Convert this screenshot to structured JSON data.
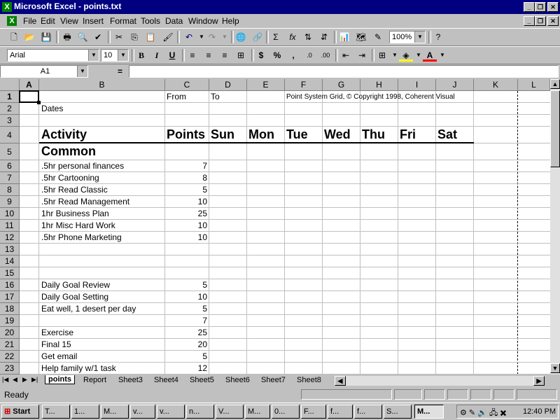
{
  "window": {
    "title": "Microsoft Excel - points.txt",
    "app_icon": "excel-icon"
  },
  "menu": [
    "File",
    "Edit",
    "View",
    "Insert",
    "Format",
    "Tools",
    "Data",
    "Window",
    "Help"
  ],
  "toolbar": {
    "zoom": "100%",
    "font": "Arial",
    "size": "10"
  },
  "namebox": "A1",
  "formula_eq": "=",
  "columns": [
    "A",
    "B",
    "C",
    "D",
    "E",
    "F",
    "G",
    "H",
    "I",
    "J",
    "K",
    "L"
  ],
  "rows": [
    "1",
    "2",
    "3",
    "4",
    "5",
    "6",
    "7",
    "8",
    "9",
    "10",
    "11",
    "12",
    "13",
    "14",
    "15",
    "16",
    "17",
    "18",
    "19",
    "20",
    "21",
    "22",
    "23"
  ],
  "cells": {
    "c1": "From",
    "d1": "To",
    "f1": "Point System Grid, © Copyright 1998, Coherent Visual",
    "b2": "Dates",
    "b4": "Activity",
    "c4": "Points",
    "d4": "Sun",
    "e4": "Mon",
    "f4": "Tue",
    "g4": "Wed",
    "h4": "Thu",
    "i4": "Fri",
    "j4": "Sat",
    "b5": "Common",
    "b6": ".5hr personal finances",
    "c6": "7",
    "b7": ".5hr Cartooning",
    "c7": "8",
    "b8": ".5hr Read Classic",
    "c8": "5",
    "b9": ".5hr Read Management",
    "c9": "10",
    "b10": "1hr Business Plan",
    "c10": "25",
    "b11": "1hr Misc Hard Work",
    "c11": "10",
    "b12": ".5hr Phone Marketing",
    "c12": "10",
    "b16": "Daily Goal Review",
    "c16": "5",
    "b17": "Daily Goal Setting",
    "c17": "10",
    "b18": "Eat well, 1 desert per day",
    "c18": "5",
    "c19": "7",
    "b20": "Exercise",
    "c20": "25",
    "b21": "Final 15",
    "c21": "20",
    "b22": "Get email",
    "c22": "5",
    "b23": "Help family w/1 task",
    "c23": "12"
  },
  "sheets": [
    "points",
    "Report",
    "Sheet3",
    "Sheet4",
    "Sheet5",
    "Sheet6",
    "Sheet7",
    "Sheet8"
  ],
  "status": "Ready",
  "taskbar": {
    "start": "Start",
    "items": [
      "T...",
      "1...",
      "M...",
      "v...",
      "v...",
      "n...",
      "V...",
      "M...",
      "0...",
      "F...",
      "f...",
      "f...",
      "S...",
      "M..."
    ],
    "clock": "12:40 PM"
  }
}
